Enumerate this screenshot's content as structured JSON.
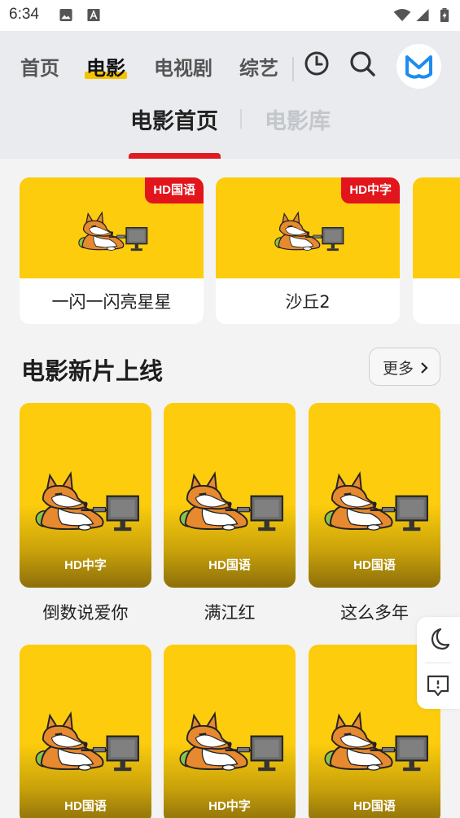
{
  "status_bar": {
    "time": "6:34"
  },
  "nav": {
    "tabs": [
      "首页",
      "电影",
      "电视剧",
      "综艺"
    ],
    "active_tab": "电影"
  },
  "subtabs": {
    "items": [
      "电影首页",
      "电影库"
    ],
    "active": "电影首页"
  },
  "carousel": [
    {
      "title": "一闪一闪亮星星",
      "badge": "HD国语"
    },
    {
      "title": "沙丘2",
      "badge": "HD中字"
    }
  ],
  "section": {
    "title": "电影新片上线",
    "more_label": "更多"
  },
  "movies": [
    {
      "title": "倒数说爱你",
      "badge": "HD中字"
    },
    {
      "title": "满江红",
      "badge": "HD国语"
    },
    {
      "title": "这么多年",
      "badge": "HD国语"
    },
    {
      "badge": "HD国语"
    },
    {
      "badge": "HD中字"
    },
    {
      "badge": "HD国语"
    }
  ],
  "icons": {
    "history": "clock-icon",
    "search": "search-icon",
    "logo": "m-logo-icon",
    "theme": "moon-icon",
    "feedback": "feedback-icon"
  },
  "colors": {
    "accent_red": "#e2151c",
    "poster_yellow": "#fccc0d",
    "tab_highlight": "#f5c400",
    "logo_blue": "#1d8cf0"
  }
}
